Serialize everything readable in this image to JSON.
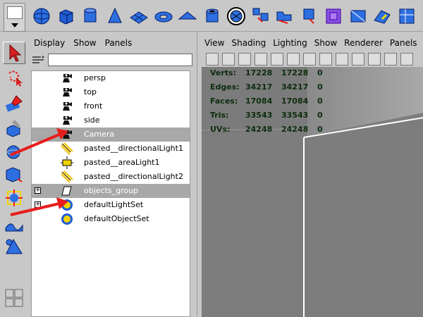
{
  "outliner": {
    "menu": [
      "Display",
      "Show",
      "Panels"
    ],
    "items": [
      {
        "label": "persp",
        "icon": "camera-icon",
        "highlighted": false,
        "expandable": false
      },
      {
        "label": "top",
        "icon": "camera-icon",
        "highlighted": false,
        "expandable": false
      },
      {
        "label": "front",
        "icon": "camera-icon",
        "highlighted": false,
        "expandable": false
      },
      {
        "label": "side",
        "icon": "camera-icon",
        "highlighted": false,
        "expandable": false
      },
      {
        "label": "Camera",
        "icon": "camera-icon",
        "highlighted": true,
        "expandable": false
      },
      {
        "label": "pasted__directionalLight1",
        "icon": "directional-light-icon",
        "highlighted": false,
        "expandable": false
      },
      {
        "label": "pasted__areaLight1",
        "icon": "area-light-icon",
        "highlighted": false,
        "expandable": false
      },
      {
        "label": "pasted__directionalLight2",
        "icon": "directional-light-icon",
        "highlighted": false,
        "expandable": false
      },
      {
        "label": "objects_group",
        "icon": "group-icon",
        "highlighted": true,
        "expandable": true
      },
      {
        "label": "defaultLightSet",
        "icon": "set-icon",
        "highlighted": false,
        "expandable": true
      },
      {
        "label": "defaultObjectSet",
        "icon": "set-icon",
        "highlighted": false,
        "expandable": false
      }
    ]
  },
  "viewport": {
    "menu": [
      "View",
      "Shading",
      "Lighting",
      "Show",
      "Renderer",
      "Panels"
    ],
    "hud": [
      {
        "label": "Verts:",
        "v1": "17228",
        "v2": "17228",
        "v3": "0"
      },
      {
        "label": "Edges:",
        "v1": "34217",
        "v2": "34217",
        "v3": "0"
      },
      {
        "label": "Faces:",
        "v1": "17084",
        "v2": "17084",
        "v3": "0"
      },
      {
        "label": "Tris:",
        "v1": "33543",
        "v2": "33543",
        "v3": "0"
      },
      {
        "label": "UVs:",
        "v1": "24248",
        "v2": "24248",
        "v3": "0"
      }
    ]
  },
  "shelf_icons": [
    "sphere-icon",
    "cube-icon",
    "cylinder-icon",
    "cone-icon",
    "plane-icon",
    "torus-icon",
    "prism-icon",
    "pipe-icon",
    "soccer-ball-icon",
    "extrude-icon",
    "bridge-icon",
    "wedge-icon",
    "lattice-icon",
    "subdiv-icon",
    "smooth-icon",
    "bevel-icon"
  ],
  "toolbox_icons": [
    "select-tool-icon",
    "lasso-tool-icon",
    "paint-select-icon",
    "move-tool-icon",
    "rotate-tool-icon",
    "scale-tool-icon",
    "manipulator-icon",
    "soft-mod-icon",
    "last-tool-icon",
    "layout-icon"
  ],
  "colors": {
    "highlight": "#a8a8a8",
    "arrow": "#e81c1c",
    "hud_text": "#0d2c0d",
    "viewport_bg": "#7a7a7a"
  }
}
